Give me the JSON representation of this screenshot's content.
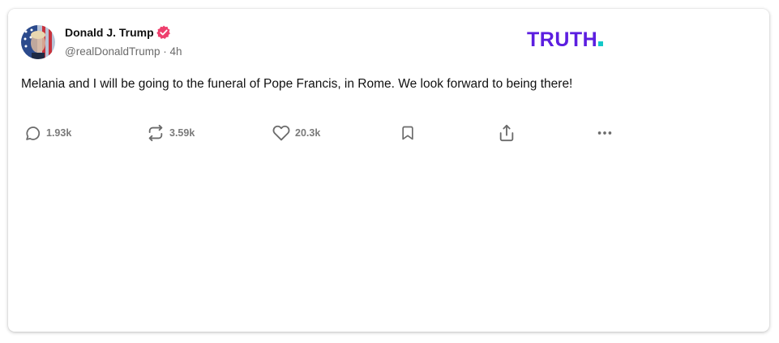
{
  "post": {
    "author_name": "Donald J. Trump",
    "handle": "@realDonaldTrump",
    "separator": "·",
    "time_ago": "4h",
    "verified": true,
    "text": "Melania and I will be going to the funeral of Pope Francis, in Rome. We look forward to being there!"
  },
  "brand": {
    "logo_text": "TRUTH",
    "logo_color": "#5c1ee0",
    "logo_dot_color": "#14c8c8"
  },
  "actions": {
    "replies": "1.93k",
    "retruths": "3.59k",
    "likes": "20.3k"
  },
  "colors": {
    "verified_badge": "#ee3f6d",
    "icon_gray": "#6b6b6b"
  },
  "icons": [
    "avatar",
    "verified-badge-icon",
    "reply-icon",
    "retruth-icon",
    "like-icon",
    "bookmark-icon",
    "share-icon",
    "more-icon"
  ]
}
